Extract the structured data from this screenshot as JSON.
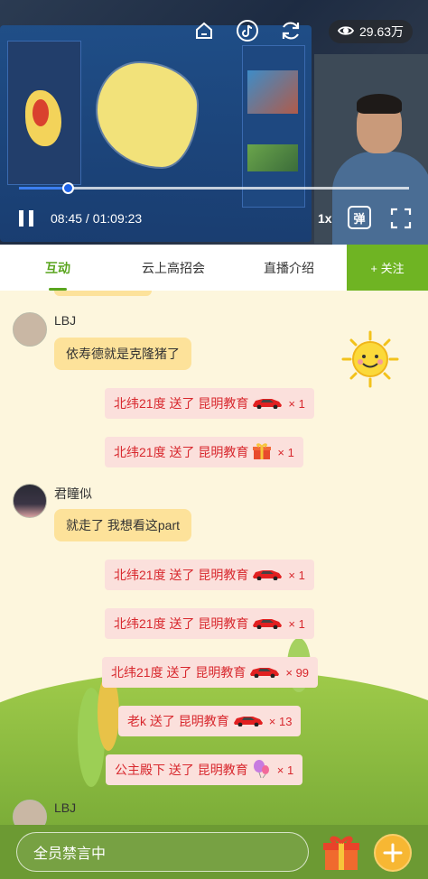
{
  "video": {
    "views": "29.63万",
    "time": "08:45 / 01:09:23",
    "progress_fraction": 0.126,
    "speed": "1x",
    "danmu_label": "弹"
  },
  "tabs": [
    {
      "label": "互动",
      "active": true
    },
    {
      "label": "云上高招会",
      "active": false
    },
    {
      "label": "直播介绍",
      "active": false
    }
  ],
  "follow_label": "+ 关注",
  "chat": {
    "messages": [
      {
        "user": "LBJ",
        "text": "依寿德就是克隆猪了"
      },
      {
        "user": "君瞳似",
        "text": "就走了  我想看这part"
      },
      {
        "user": "LBJ",
        "text": ""
      }
    ],
    "gifts": [
      {
        "text": "北纬21度 送了 昆明教育",
        "icon": "sports-car-icon",
        "count": "× 1"
      },
      {
        "text": "北纬21度 送了 昆明教育",
        "icon": "gift-box-icon",
        "count": "× 1"
      },
      {
        "text": "北纬21度 送了 昆明教育",
        "icon": "sports-car-icon",
        "count": "× 1"
      },
      {
        "text": "北纬21度 送了 昆明教育",
        "icon": "sports-car-icon",
        "count": "× 1"
      },
      {
        "text": "北纬21度 送了 昆明教育",
        "icon": "sports-car-icon",
        "count": "× 99"
      },
      {
        "text": "老k 送了 昆明教育",
        "icon": "sports-car-icon",
        "count": "× 13"
      },
      {
        "text": "公主殿下 送了 昆明教育",
        "icon": "balloon-icon",
        "count": "× 1"
      }
    ]
  },
  "bottom": {
    "input_text": "全员禁言中"
  },
  "colors": {
    "accent_green": "#5aa51e",
    "follow_bg": "#6fb423",
    "bubble_bg": "#fde29a",
    "gift_bg": "#fbe0dc",
    "gift_text": "#d8282e",
    "chat_bg": "#fdf6dd",
    "bottom_bg": "#6c9a33"
  }
}
